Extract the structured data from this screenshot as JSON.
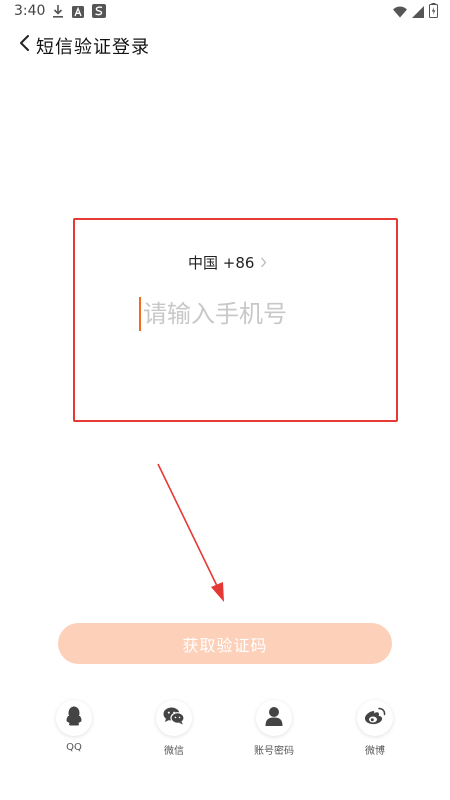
{
  "status_bar": {
    "time": "3:40"
  },
  "header": {
    "title": "短信验证登录"
  },
  "form": {
    "country": "中国 +86",
    "phone_placeholder": "请输入手机号",
    "phone_value": ""
  },
  "actions": {
    "get_code_label": "获取验证码"
  },
  "login_options": [
    {
      "label": "QQ",
      "icon": "qq-icon"
    },
    {
      "label": "微信",
      "icon": "wechat-icon"
    },
    {
      "label": "账号密码",
      "icon": "user-icon"
    },
    {
      "label": "微博",
      "icon": "weibo-icon"
    }
  ],
  "colors": {
    "highlight_border": "#e53935",
    "button_bg": "#fdd0ba",
    "caret": "#f26b1d"
  }
}
